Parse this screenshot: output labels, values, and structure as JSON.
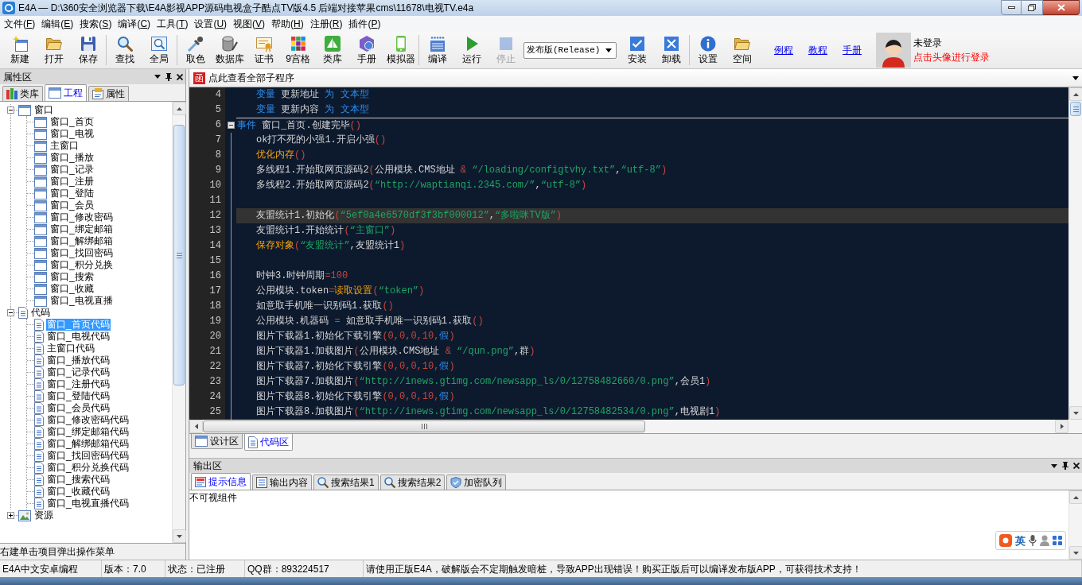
{
  "window": {
    "title": "E4A — D:\\360安全浏览器下载\\E4A影视APP源码电视盒子酷点TV版4.5 后端对接苹果cms\\11678\\电视TV.e4a"
  },
  "menu": [
    "文件(F)",
    "编辑(E)",
    "搜索(S)",
    "编译(C)",
    "工具(T)",
    "设置(U)",
    "视图(V)",
    "帮助(H)",
    "注册(R)",
    "插件(P)"
  ],
  "toolbar": [
    {
      "kind": "button",
      "label": "新建",
      "disabled": false
    },
    {
      "kind": "button",
      "label": "打开",
      "disabled": false
    },
    {
      "kind": "button",
      "label": "保存",
      "disabled": false
    },
    {
      "kind": "separator"
    },
    {
      "kind": "button",
      "label": "查找",
      "disabled": false
    },
    {
      "kind": "button",
      "label": "全局",
      "disabled": false
    },
    {
      "kind": "separator"
    },
    {
      "kind": "button",
      "label": "取色",
      "disabled": false
    },
    {
      "kind": "button",
      "label": "数据库",
      "disabled": false
    },
    {
      "kind": "button",
      "label": "证书",
      "disabled": false
    },
    {
      "kind": "button",
      "label": "9宫格",
      "disabled": false
    },
    {
      "kind": "button",
      "label": "类库",
      "disabled": false
    },
    {
      "kind": "button",
      "label": "手册",
      "disabled": false
    },
    {
      "kind": "button",
      "label": "模拟器",
      "disabled": false
    },
    {
      "kind": "separator"
    },
    {
      "kind": "button",
      "label": "编译",
      "disabled": false
    },
    {
      "kind": "button",
      "label": "运行",
      "disabled": false
    },
    {
      "kind": "button",
      "label": "停止",
      "disabled": true
    },
    {
      "kind": "dropdown",
      "value": "发布版(Release)"
    },
    {
      "kind": "button",
      "label": "安装",
      "disabled": false
    },
    {
      "kind": "button",
      "label": "卸载",
      "disabled": false
    },
    {
      "kind": "separator"
    },
    {
      "kind": "button",
      "label": "设置",
      "disabled": false
    },
    {
      "kind": "button",
      "label": "空间",
      "disabled": false
    },
    {
      "kind": "link",
      "label": "例程"
    },
    {
      "kind": "link",
      "label": "教程"
    },
    {
      "kind": "link",
      "label": "手册"
    }
  ],
  "user": {
    "status": "未登录",
    "hint": "点击头像进行登录"
  },
  "left_panel": {
    "title": "属性区",
    "tabs": [
      {
        "label": "类库",
        "selected": false
      },
      {
        "label": "工程",
        "selected": true
      },
      {
        "label": "属性",
        "selected": false
      }
    ],
    "tree": [
      {
        "kind": "window",
        "label": "窗口",
        "expanded": true,
        "selected": false,
        "children": [
          {
            "label": "窗口_首页",
            "selected": false
          },
          {
            "label": "窗口_电视",
            "selected": false
          },
          {
            "label": "主窗口",
            "selected": false
          },
          {
            "label": "窗口_播放",
            "selected": false
          },
          {
            "label": "窗口_记录",
            "selected": false
          },
          {
            "label": "窗口_注册",
            "selected": false
          },
          {
            "label": "窗口_登陆",
            "selected": false
          },
          {
            "label": "窗口_会员",
            "selected": false
          },
          {
            "label": "窗口_修改密码",
            "selected": false
          },
          {
            "label": "窗口_绑定邮箱",
            "selected": false
          },
          {
            "label": "窗口_解绑邮箱",
            "selected": false
          },
          {
            "label": "窗口_找回密码",
            "selected": false
          },
          {
            "label": "窗口_积分兑换",
            "selected": false
          },
          {
            "label": "窗口_搜索",
            "selected": false
          },
          {
            "label": "窗口_收藏",
            "selected": false
          },
          {
            "label": "窗口_电视直播",
            "selected": false
          }
        ]
      },
      {
        "kind": "code",
        "label": "代码",
        "expanded": true,
        "selected": false,
        "children": [
          {
            "label": "窗口_首页代码",
            "selected": true
          },
          {
            "label": "窗口_电视代码",
            "selected": false
          },
          {
            "label": "主窗口代码",
            "selected": false
          },
          {
            "label": "窗口_播放代码",
            "selected": false
          },
          {
            "label": "窗口_记录代码",
            "selected": false
          },
          {
            "label": "窗口_注册代码",
            "selected": false
          },
          {
            "label": "窗口_登陆代码",
            "selected": false
          },
          {
            "label": "窗口_会员代码",
            "selected": false
          },
          {
            "label": "窗口_修改密码代码",
            "selected": false
          },
          {
            "label": "窗口_绑定邮箱代码",
            "selected": false
          },
          {
            "label": "窗口_解绑邮箱代码",
            "selected": false
          },
          {
            "label": "窗口_找回密码代码",
            "selected": false
          },
          {
            "label": "窗口_积分兑换代码",
            "selected": false
          },
          {
            "label": "窗口_搜索代码",
            "selected": false
          },
          {
            "label": "窗口_收藏代码",
            "selected": false
          },
          {
            "label": "窗口_电视直播代码",
            "selected": false
          }
        ]
      },
      {
        "kind": "resource",
        "label": "资源",
        "expanded": false,
        "selected": false
      }
    ],
    "hint": "右建单击项目弹出操作菜单"
  },
  "editor": {
    "function_bar": {
      "badge": "函",
      "label": "点此查看全部子程序"
    },
    "lines": [
      {
        "number": "4",
        "kind": "declaration",
        "current": false,
        "tokens": [
          {
            "text": "变量",
            "kind": "keyword"
          },
          {
            "text": " 更新地址 ",
            "kind": "plain"
          },
          {
            "text": "为 文本型",
            "kind": "keyword"
          }
        ]
      },
      {
        "number": "5",
        "kind": "declaration",
        "current": false,
        "tokens": [
          {
            "text": "变量",
            "kind": "keyword"
          },
          {
            "text": " 更新内容 ",
            "kind": "plain"
          },
          {
            "text": "为 文本型",
            "kind": "keyword"
          }
        ]
      },
      {
        "number": "6",
        "kind": "event",
        "current": false,
        "tokens": [
          {
            "text": "事件",
            "kind": "keyword"
          },
          {
            "text": " 窗口_首页.创建完毕",
            "kind": "plain"
          },
          {
            "text": "()",
            "kind": "operator"
          }
        ]
      },
      {
        "number": "7",
        "kind": "statement",
        "current": false,
        "tokens": [
          {
            "text": "ok打不死的小强1.开启小强",
            "kind": "plain"
          },
          {
            "text": "()",
            "kind": "operator"
          }
        ]
      },
      {
        "number": "8",
        "kind": "statement",
        "current": false,
        "tokens": [
          {
            "text": "优化内存",
            "kind": "function"
          },
          {
            "text": "()",
            "kind": "operator"
          }
        ]
      },
      {
        "number": "9",
        "kind": "statement",
        "current": false,
        "tokens": [
          {
            "text": "多线程1.开始取网页源码2",
            "kind": "plain"
          },
          {
            "text": "(",
            "kind": "operator"
          },
          {
            "text": "公用模块.CMS地址 ",
            "kind": "plain"
          },
          {
            "text": "&",
            "kind": "operator"
          },
          {
            "text": " “/loading/configtvhy.txt”",
            "kind": "string"
          },
          {
            "text": ",",
            "kind": "plain"
          },
          {
            "text": "“utf-8”",
            "kind": "string"
          },
          {
            "text": ")",
            "kind": "operator"
          }
        ]
      },
      {
        "number": "10",
        "kind": "statement",
        "current": false,
        "tokens": [
          {
            "text": "多线程2.开始取网页源码2",
            "kind": "plain"
          },
          {
            "text": "(",
            "kind": "operator"
          },
          {
            "text": "“http://waptianqi.2345.com/”",
            "kind": "string"
          },
          {
            "text": ",",
            "kind": "plain"
          },
          {
            "text": "“utf-8”",
            "kind": "string"
          },
          {
            "text": ")",
            "kind": "operator"
          }
        ]
      },
      {
        "number": "11",
        "kind": "statement",
        "current": false
      },
      {
        "number": "12",
        "kind": "statement",
        "current": true,
        "tokens": [
          {
            "text": "友盟统计1.初始化",
            "kind": "plain"
          },
          {
            "text": "(",
            "kind": "operator"
          },
          {
            "text": "“5ef0a4e6570df3f3bf000012”",
            "kind": "string"
          },
          {
            "text": ",",
            "kind": "plain"
          },
          {
            "text": "“多啦咪TV版”",
            "kind": "string"
          },
          {
            "text": ")",
            "kind": "operator"
          }
        ]
      },
      {
        "number": "13",
        "kind": "statement",
        "current": false,
        "tokens": [
          {
            "text": "友盟统计1.开始统计",
            "kind": "plain"
          },
          {
            "text": "(",
            "kind": "operator"
          },
          {
            "text": "“主窗口”",
            "kind": "string"
          },
          {
            "text": ")",
            "kind": "operator"
          }
        ]
      },
      {
        "number": "14",
        "kind": "statement",
        "current": false,
        "tokens": [
          {
            "text": "保存对象",
            "kind": "function"
          },
          {
            "text": "(",
            "kind": "operator"
          },
          {
            "text": "“友盟统计”",
            "kind": "string"
          },
          {
            "text": ",友盟统计1",
            "kind": "plain"
          },
          {
            "text": ")",
            "kind": "operator"
          }
        ]
      },
      {
        "number": "15",
        "kind": "statement",
        "current": false
      },
      {
        "number": "16",
        "kind": "statement",
        "current": false,
        "tokens": [
          {
            "text": "时钟3.时钟周期",
            "kind": "plain"
          },
          {
            "text": "=100",
            "kind": "operator"
          }
        ]
      },
      {
        "number": "17",
        "kind": "statement",
        "current": false,
        "tokens": [
          {
            "text": "公用模块.token",
            "kind": "plain"
          },
          {
            "text": "=",
            "kind": "operator"
          },
          {
            "text": "读取设置",
            "kind": "function"
          },
          {
            "text": "(",
            "kind": "operator"
          },
          {
            "text": "“token”",
            "kind": "string"
          },
          {
            "text": ")",
            "kind": "operator"
          }
        ]
      },
      {
        "number": "18",
        "kind": "statement",
        "current": false,
        "tokens": [
          {
            "text": "如意取手机唯一识别码1.获取",
            "kind": "plain"
          },
          {
            "text": "()",
            "kind": "operator"
          }
        ]
      },
      {
        "number": "19",
        "kind": "statement",
        "current": false,
        "tokens": [
          {
            "text": "公用模块.机器码 ",
            "kind": "plain"
          },
          {
            "text": "=",
            "kind": "operator"
          },
          {
            "text": " 如意取手机唯一识别码1.获取",
            "kind": "plain"
          },
          {
            "text": "()",
            "kind": "operator"
          }
        ]
      },
      {
        "number": "20",
        "kind": "statement",
        "current": false,
        "tokens": [
          {
            "text": "图片下载器1.初始化下载引擎",
            "kind": "plain"
          },
          {
            "text": "(0,0,0,10,",
            "kind": "operator"
          },
          {
            "text": "假",
            "kind": "keyword"
          },
          {
            "text": ")",
            "kind": "operator"
          }
        ]
      },
      {
        "number": "21",
        "kind": "statement",
        "current": false,
        "tokens": [
          {
            "text": "图片下载器1.加载图片",
            "kind": "plain"
          },
          {
            "text": "(",
            "kind": "operator"
          },
          {
            "text": "公用模块.CMS地址 ",
            "kind": "plain"
          },
          {
            "text": "&",
            "kind": "operator"
          },
          {
            "text": " “/qun.png”",
            "kind": "string"
          },
          {
            "text": ",群",
            "kind": "plain"
          },
          {
            "text": ")",
            "kind": "operator"
          }
        ]
      },
      {
        "number": "22",
        "kind": "statement",
        "current": false,
        "tokens": [
          {
            "text": "图片下载器7.初始化下载引擎",
            "kind": "plain"
          },
          {
            "text": "(0,0,0,10,",
            "kind": "operator"
          },
          {
            "text": "假",
            "kind": "keyword"
          },
          {
            "text": ")",
            "kind": "operator"
          }
        ]
      },
      {
        "number": "23",
        "kind": "statement",
        "current": false,
        "tokens": [
          {
            "text": "图片下载器7.加载图片",
            "kind": "plain"
          },
          {
            "text": "(",
            "kind": "operator"
          },
          {
            "text": "“http://inews.gtimg.com/newsapp_ls/0/12758482660/0.png”",
            "kind": "string"
          },
          {
            "text": ",会员1",
            "kind": "plain"
          },
          {
            "text": ")",
            "kind": "operator"
          }
        ]
      },
      {
        "number": "24",
        "kind": "statement",
        "current": false,
        "tokens": [
          {
            "text": "图片下载器8.初始化下载引擎",
            "kind": "plain"
          },
          {
            "text": "(0,0,0,10,",
            "kind": "operator"
          },
          {
            "text": "假",
            "kind": "keyword"
          },
          {
            "text": ")",
            "kind": "operator"
          }
        ]
      },
      {
        "number": "25",
        "kind": "statement",
        "current": false,
        "tokens": [
          {
            "text": "图片下载器8.加载图片",
            "kind": "plain"
          },
          {
            "text": "(",
            "kind": "operator"
          },
          {
            "text": "“http://inews.gtimg.com/newsapp_ls/0/12758482534/0.png”",
            "kind": "string"
          },
          {
            "text": ",电视剧1",
            "kind": "plain"
          },
          {
            "text": ")",
            "kind": "operator"
          }
        ]
      }
    ],
    "tabs": [
      {
        "label": "设计区",
        "selected": false
      },
      {
        "label": "代码区",
        "selected": true
      }
    ]
  },
  "output": {
    "title": "输出区",
    "tabs": [
      {
        "label": "提示信息",
        "selected": true
      },
      {
        "label": "输出内容",
        "selected": false
      },
      {
        "label": "搜索结果1",
        "selected": false
      },
      {
        "label": "搜索结果2",
        "selected": false
      },
      {
        "label": "加密队列",
        "selected": false
      }
    ],
    "text": "不可视组件"
  },
  "ime_bar": {
    "mode": "英"
  },
  "status_bar": [
    "E4A中文安卓编程",
    "版本：7.0",
    "状态：已注册",
    "QQ群：893224517",
    "请使用正版E4A，破解版会不定期触发暗桩，导致APP出现错误！购买正版后可以编译发布版APP，可获得技术支持！"
  ]
}
